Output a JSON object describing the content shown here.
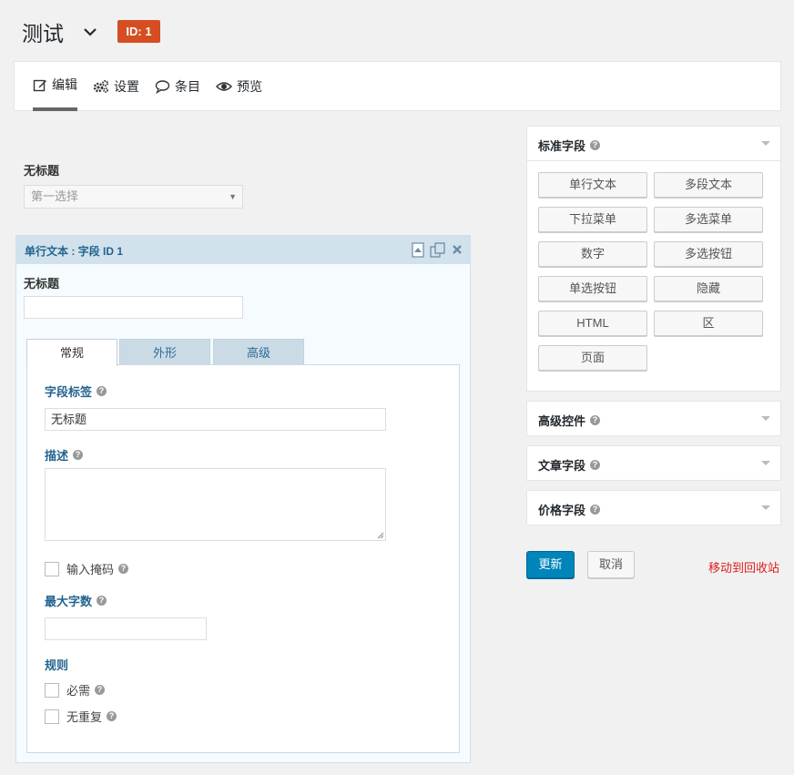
{
  "header": {
    "title": "测试",
    "id_badge": "ID: 1"
  },
  "nav": {
    "tabs": [
      {
        "label": "编辑",
        "icon": "edit-icon"
      },
      {
        "label": "设置",
        "icon": "gears-icon"
      },
      {
        "label": "条目",
        "icon": "speech-bubble-icon"
      },
      {
        "label": "预览",
        "icon": "eye-icon"
      }
    ]
  },
  "form": {
    "section_label": "无标题",
    "select_value": "第一选择"
  },
  "field": {
    "header_title": "单行文本 : 字段 ID 1",
    "label": "无标题",
    "input_value": "",
    "tabs": [
      "常规",
      "外形",
      "高级"
    ],
    "settings": {
      "field_label_title": "字段标签",
      "field_label_value": "无标题",
      "description_title": "描述",
      "description_value": "",
      "input_mask": "输入掩码",
      "max_chars_title": "最大字数",
      "max_chars_value": "",
      "rules_title": "规则",
      "required": "必需",
      "unique": "无重复"
    }
  },
  "sidebar": {
    "standard_fields": {
      "title": "标准字段",
      "buttons": [
        "单行文本",
        "多段文本",
        "下拉菜单",
        "多选菜单",
        "数字",
        "多选按钮",
        "单选按钮",
        "隐藏",
        "HTML",
        "区",
        "页面"
      ]
    },
    "advanced_controls": {
      "title": "高级控件"
    },
    "post_fields": {
      "title": "文章字段"
    },
    "price_fields": {
      "title": "价格字段"
    }
  },
  "actions": {
    "update": "更新",
    "cancel": "取消",
    "trash": "移动到回收站"
  },
  "colors": {
    "accent_blue": "#0085ba",
    "badge_orange": "#d54e21",
    "trash_red": "#dd1e1e",
    "field_blue": "#23648f"
  }
}
